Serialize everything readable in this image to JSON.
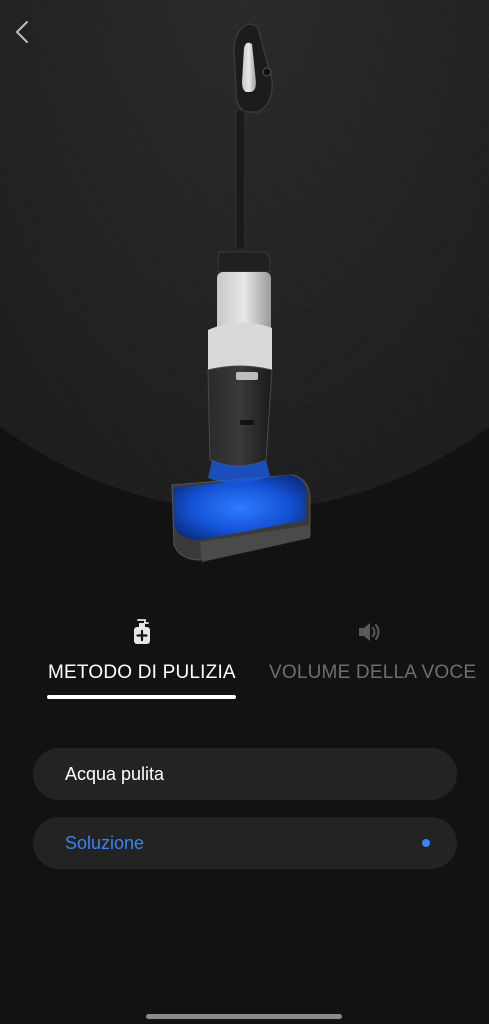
{
  "header": {
    "back_icon": "chevron-left-icon"
  },
  "hero": {
    "image": "wet-dry-vacuum-illustration",
    "accent_color": "#1e6bff"
  },
  "tabs": [
    {
      "label": "METODO DI PULIZIA",
      "icon": "cleaning-solution-bottle-icon",
      "active": true
    },
    {
      "label": "VOLUME DELLA VOCE",
      "icon": "speaker-volume-icon",
      "active": false
    }
  ],
  "options": [
    {
      "label": "Acqua pulita",
      "selected": false
    },
    {
      "label": "Soluzione",
      "selected": true
    }
  ],
  "colors": {
    "background": "#121212",
    "option_background": "#232323",
    "selected": "#3b82f6",
    "inactive_tab": "#6e6e6e"
  }
}
